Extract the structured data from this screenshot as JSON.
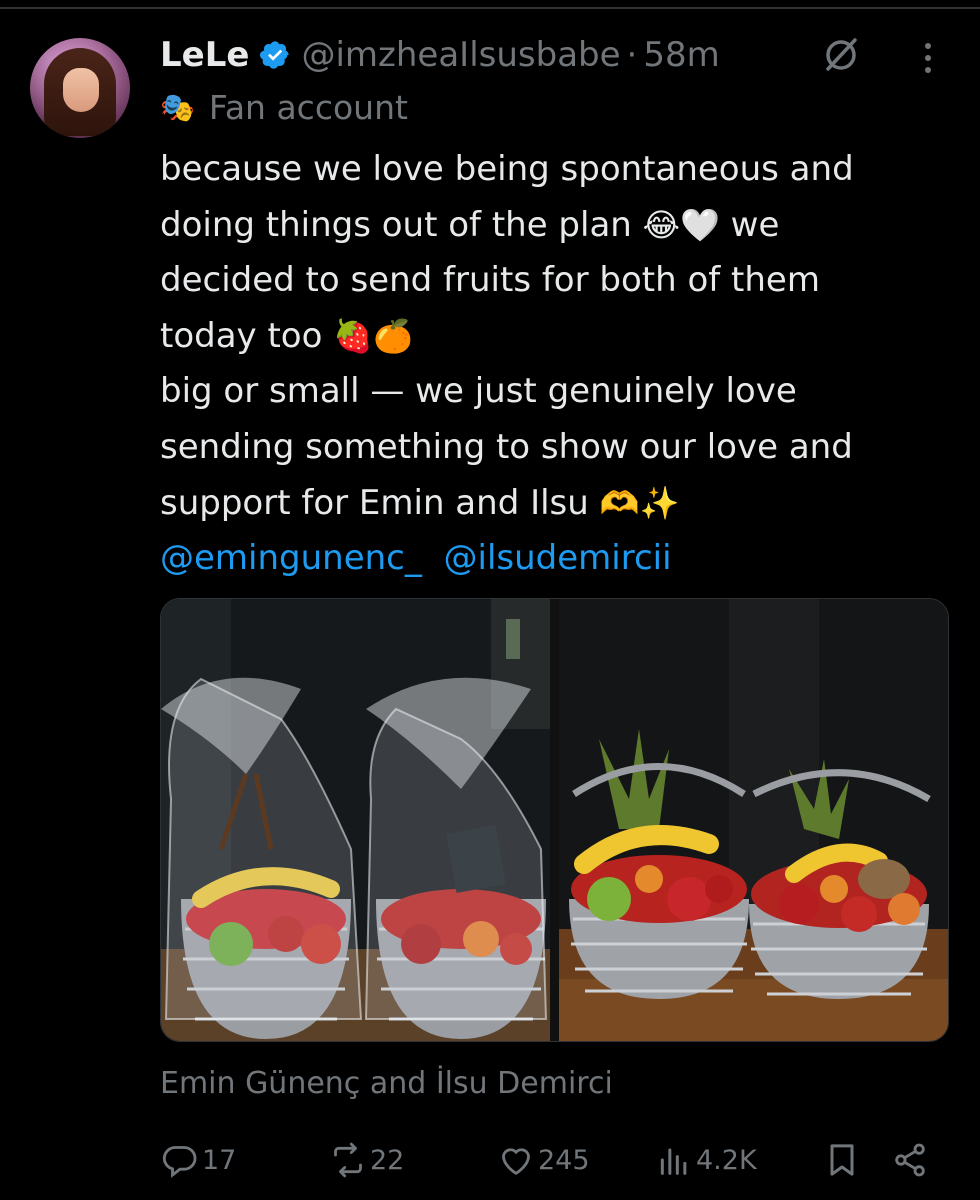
{
  "post": {
    "display_name": "LeLe",
    "handle": "@imzheaIlsusbabe",
    "separator": "·",
    "time": "58m",
    "affiliation": "Fan account",
    "text_lines": [
      "because we love being spontaneous and",
      "doing things out of the plan ",
      " we",
      "decided to send fruits for both of them",
      "today too ",
      "big or small — we just genuinely love",
      "sending something to show our love and",
      "support for Emin and Ilsu "
    ],
    "emojis": {
      "line2": "😂🤍",
      "line4": "🍓🍊",
      "line7": "🫶✨"
    },
    "mentions": [
      "@emingunenc_",
      "@ilsudemircii"
    ],
    "media_caption": "Emin Günenç and İlsu Demirci"
  },
  "actions": {
    "replies": "17",
    "reposts": "22",
    "likes": "245",
    "views": "4.2K"
  },
  "icons": {
    "verified": "verified-badge-icon",
    "grok": "grok-icon",
    "more": "more-icon",
    "affiliation": "theater-mask-icon",
    "reply": "reply-icon",
    "repost": "repost-icon",
    "like": "heart-icon",
    "views": "views-icon",
    "bookmark": "bookmark-icon",
    "share": "share-icon"
  },
  "colors": {
    "background": "#000000",
    "text": "#e7e9ea",
    "secondary": "#71767b",
    "link": "#1d9bf0",
    "verified": "#1d9bf0"
  }
}
